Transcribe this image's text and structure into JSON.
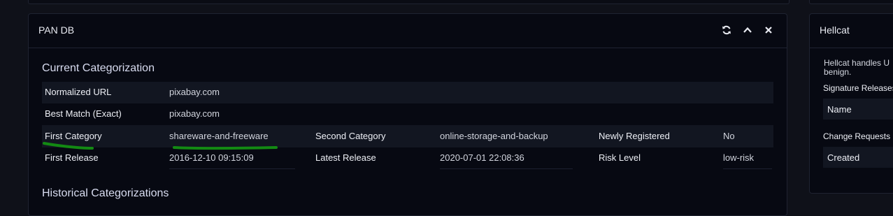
{
  "main_panel": {
    "title": "PAN DB",
    "actions": [
      {
        "name": "refresh",
        "icon": "refresh-icon"
      },
      {
        "name": "collapse",
        "icon": "chevron-up-icon"
      },
      {
        "name": "close",
        "icon": "close-icon"
      }
    ],
    "current_section_title": "Current Categorization",
    "historical_section_title": "Historical Categorizations",
    "rows": [
      {
        "label": "Normalized URL",
        "value": "pixabay.com"
      },
      {
        "label": "Best Match (Exact)",
        "value": "pixabay.com"
      }
    ],
    "grid": [
      [
        {
          "label": "First Category",
          "value": "shareware-and-freeware"
        },
        {
          "label": "Second Category",
          "value": "online-storage-and-backup"
        },
        {
          "label": "Newly Registered",
          "value": "No"
        }
      ],
      [
        {
          "label": "First Release",
          "value": "2016-12-10 09:15:09"
        },
        {
          "label": "Latest Release",
          "value": "2020-07-01 22:08:36"
        },
        {
          "label": "Risk Level",
          "value": "low-risk"
        }
      ]
    ],
    "annotation_color": "#138a13"
  },
  "side_panel": {
    "title": "Hellcat",
    "description_lines": [
      "Hellcat handles U",
      "benign."
    ],
    "signature_releases_label": "Signature Releases",
    "signature_column": "Name",
    "change_requests_label": "Change Requests",
    "change_column": "Created"
  },
  "colors": {
    "background": "#0f1119",
    "panel": "#070912",
    "stripe": "#121621",
    "border": "#1f2331"
  }
}
